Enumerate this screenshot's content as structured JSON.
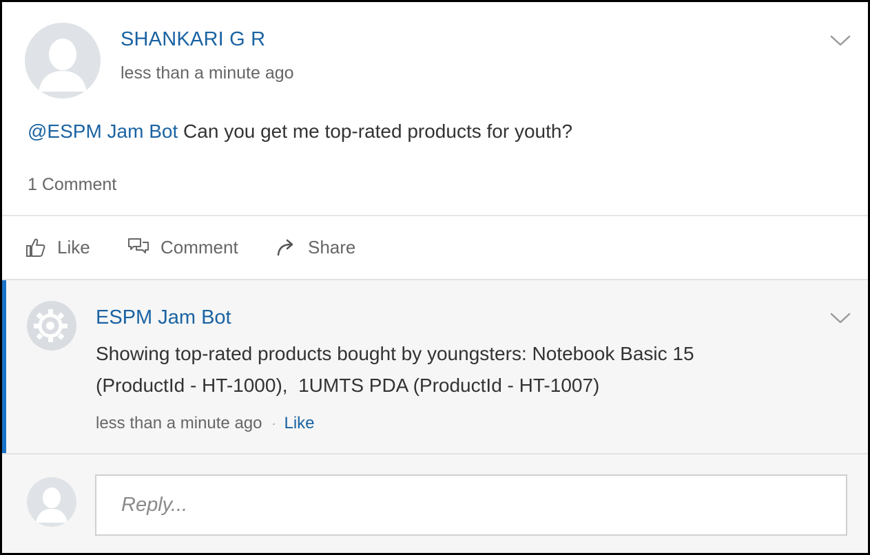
{
  "post": {
    "author": "SHANKARI G R",
    "time": "less than a minute ago",
    "mention": "@ESPM Jam Bot",
    "message": " Can you get me top-rated products for youth?",
    "comment_count": "1 Comment",
    "actions": {
      "like": "Like",
      "comment": "Comment",
      "share": "Share"
    }
  },
  "comment": {
    "author": "ESPM Jam Bot",
    "text_line1": "Showing top-rated products bought by youngsters: Notebook Basic 15",
    "text_line2": "(ProductId - HT-1000),  1UMTS PDA (ProductId - HT-1007)",
    "time": "less than a minute ago",
    "separator": "·",
    "like": "Like"
  },
  "reply": {
    "placeholder": "Reply..."
  },
  "colors": {
    "link": "#1a63a2",
    "accent_bar": "#1a73c7",
    "muted_text": "#666666",
    "body_text": "#333333",
    "comment_bg": "#f6f6f6"
  },
  "icons": {
    "post_avatar": "user-silhouette-icon",
    "bot_avatar": "gear-bot-icon",
    "reply_avatar": "user-silhouette-icon",
    "like": "thumbs-up-icon",
    "comment": "speech-bubbles-icon",
    "share": "share-arrow-icon",
    "menu": "chevron-down-icon"
  }
}
